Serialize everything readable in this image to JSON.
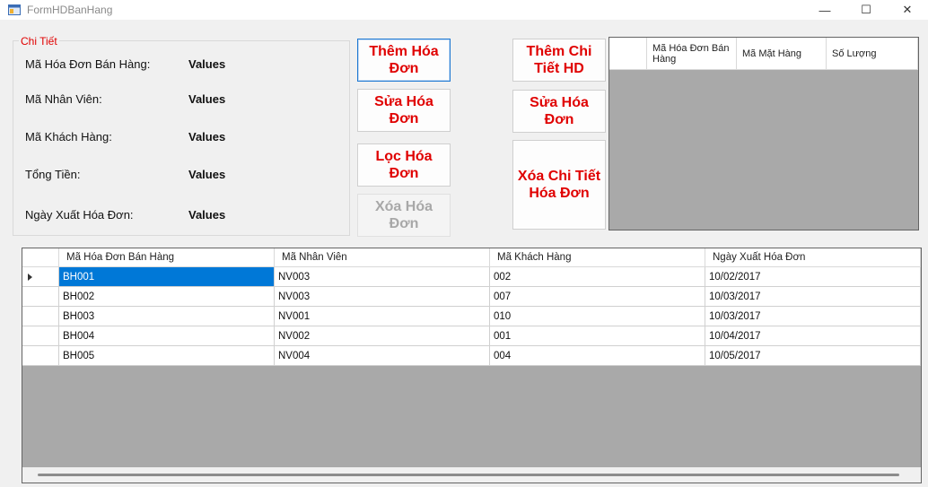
{
  "window": {
    "title": "FormHDBanHang",
    "minimize_glyph": "—",
    "maximize_glyph": "☐",
    "close_glyph": "✕"
  },
  "details": {
    "legend": "Chi Tiết",
    "fields": [
      {
        "label": "Mã Hóa Đơn Bán Hàng:",
        "value": "Values"
      },
      {
        "label": "Mã Nhân Viên:",
        "value": "Values"
      },
      {
        "label": "Mã Khách Hàng:",
        "value": "Values"
      },
      {
        "label": "Tổng Tiền:",
        "value": "Values"
      },
      {
        "label": "Ngày Xuất Hóa Đơn:",
        "value": "Values"
      }
    ]
  },
  "buttons": {
    "them_hoa_don": "Thêm Hóa Đơn",
    "sua_hoa_don": "Sửa Hóa Đơn",
    "loc_hoa_don": "Lọc Hóa Đơn",
    "xoa_hoa_don": "Xóa Hóa Đơn",
    "them_chi_tiet": "Thêm Chi Tiết HD",
    "sua_hoa_don_2": "Sửa Hóa Đơn",
    "xoa_chi_tiet": "Xóa Chi Tiết Hóa Đơn"
  },
  "detail_grid": {
    "columns": [
      "Mã Hóa Đơn Bán Hàng",
      "Mã Mặt Hàng",
      "Số Lượng"
    ]
  },
  "invoice_grid": {
    "columns": [
      "Mã Hóa Đơn Bán Hàng",
      "Mã Nhân Viên",
      "Mã Khách Hàng",
      "Ngày Xuất Hóa Đơn"
    ],
    "rows": [
      [
        "BH001",
        "NV003",
        "002",
        "10/02/2017"
      ],
      [
        "BH002",
        "NV003",
        "007",
        "10/03/2017"
      ],
      [
        "BH003",
        "NV001",
        "010",
        "10/03/2017"
      ],
      [
        "BH004",
        "NV002",
        "001",
        "10/04/2017"
      ],
      [
        "BH005",
        "NV004",
        "004",
        "10/05/2017"
      ]
    ]
  },
  "colors": {
    "accent_red": "#e00000",
    "selection_blue": "#0078d7",
    "grid_background": "#a9a9a9"
  }
}
